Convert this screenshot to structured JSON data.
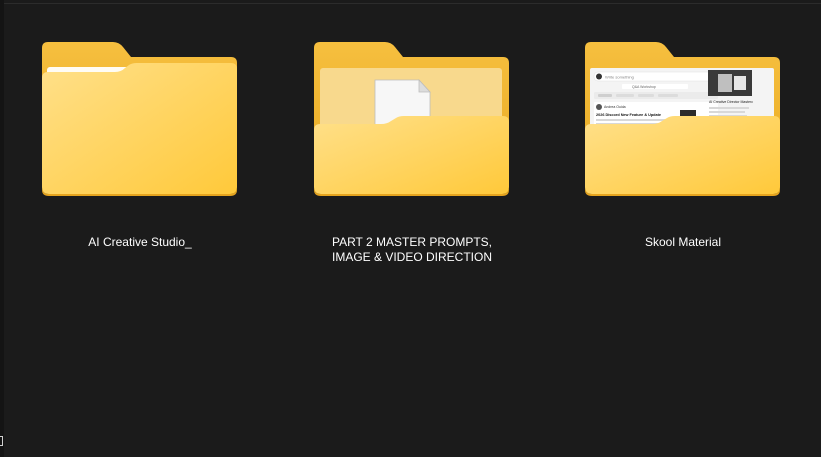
{
  "folders": [
    {
      "name": "AI Creative Studio_",
      "icon": "folder-icon"
    },
    {
      "name": "PART 2 MASTER PROMPTS, IMAGE & VIDEO DIRECTION",
      "icon": "folder-document-icon"
    },
    {
      "name": "Skool Material",
      "icon": "folder-preview-icon"
    }
  ],
  "preview": {
    "search_placeholder": "Write something",
    "banner": "Q&A Workshop",
    "post_author": "Andrea Ouida",
    "post_title": "2026 Discord New Feature & Update",
    "side_title": "AI Creative Director Masterc"
  },
  "colors": {
    "background": "#1b1b1b",
    "folder_back": "#f5be3d",
    "folder_front": "#ffd766",
    "text": "#ffffff"
  }
}
